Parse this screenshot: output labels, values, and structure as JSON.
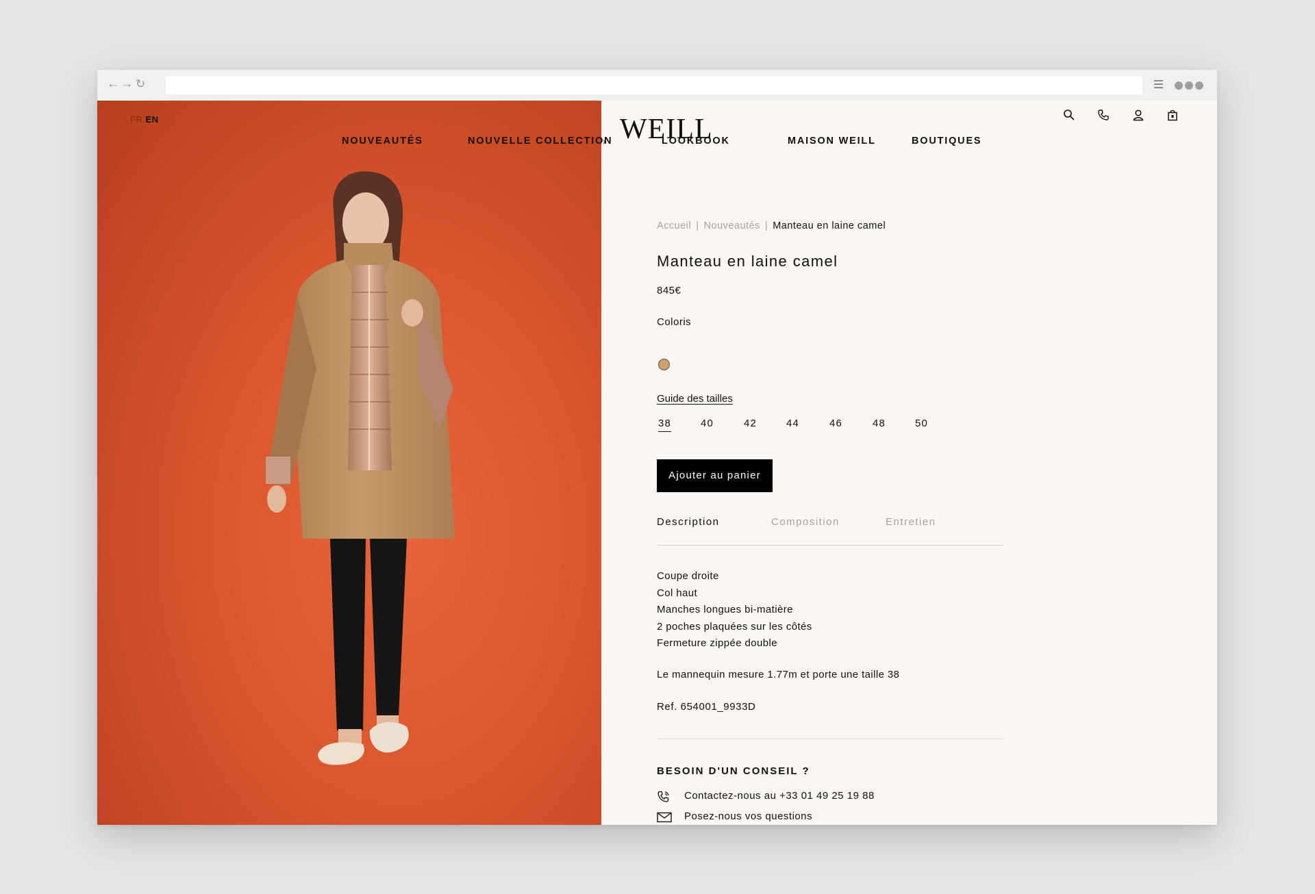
{
  "site": {
    "logo": "WEILL",
    "languages": {
      "fr": "FR",
      "en": "EN"
    },
    "nav": [
      "NOUVEAUTÉS",
      "NOUVELLE COLLECTION",
      "LOOKBOOK",
      "MAISON WEILL",
      "BOUTIQUES"
    ]
  },
  "breadcrumb": {
    "home": "Accueil",
    "section": "Nouveautés",
    "current": "Manteau en laine camel",
    "separator": "|"
  },
  "product": {
    "title": "Manteau en laine camel",
    "price": "845€",
    "colors_label": "Coloris",
    "color_swatch": "#cda26f",
    "size_guide": "Guide des tailles",
    "sizes": [
      "38",
      "40",
      "42",
      "44",
      "46",
      "48",
      "50"
    ],
    "selected_size": "38",
    "add_to_cart": "Ajouter au panier",
    "tabs": [
      "Description",
      "Composition",
      "Entretien"
    ],
    "active_tab": "Description",
    "description": [
      "Coupe droite",
      "Col haut",
      "Manches longues bi-matière",
      "2 poches plaquées sur les côtés",
      "Fermeture zippée double"
    ],
    "model_info": "Le mannequin mesure 1.77m et porte une taille 38",
    "reference": "Ref. 654001_9933D"
  },
  "help": {
    "title": "BESOIN D'UN CONSEIL ?",
    "phone": "Contactez-nous au +33 01 49 25 19 88",
    "question": "Posez-nous vos questions"
  },
  "icons": [
    "back-arrow-icon",
    "forward-arrow-icon",
    "reload-icon",
    "menu-icon",
    "more-dots-icon",
    "search-icon",
    "phone-icon",
    "user-icon",
    "shopping-bag-icon",
    "mail-icon"
  ],
  "colors": {
    "photo_background": "#d9552d",
    "page_background": "#faf6f1",
    "accent": "#000000"
  }
}
